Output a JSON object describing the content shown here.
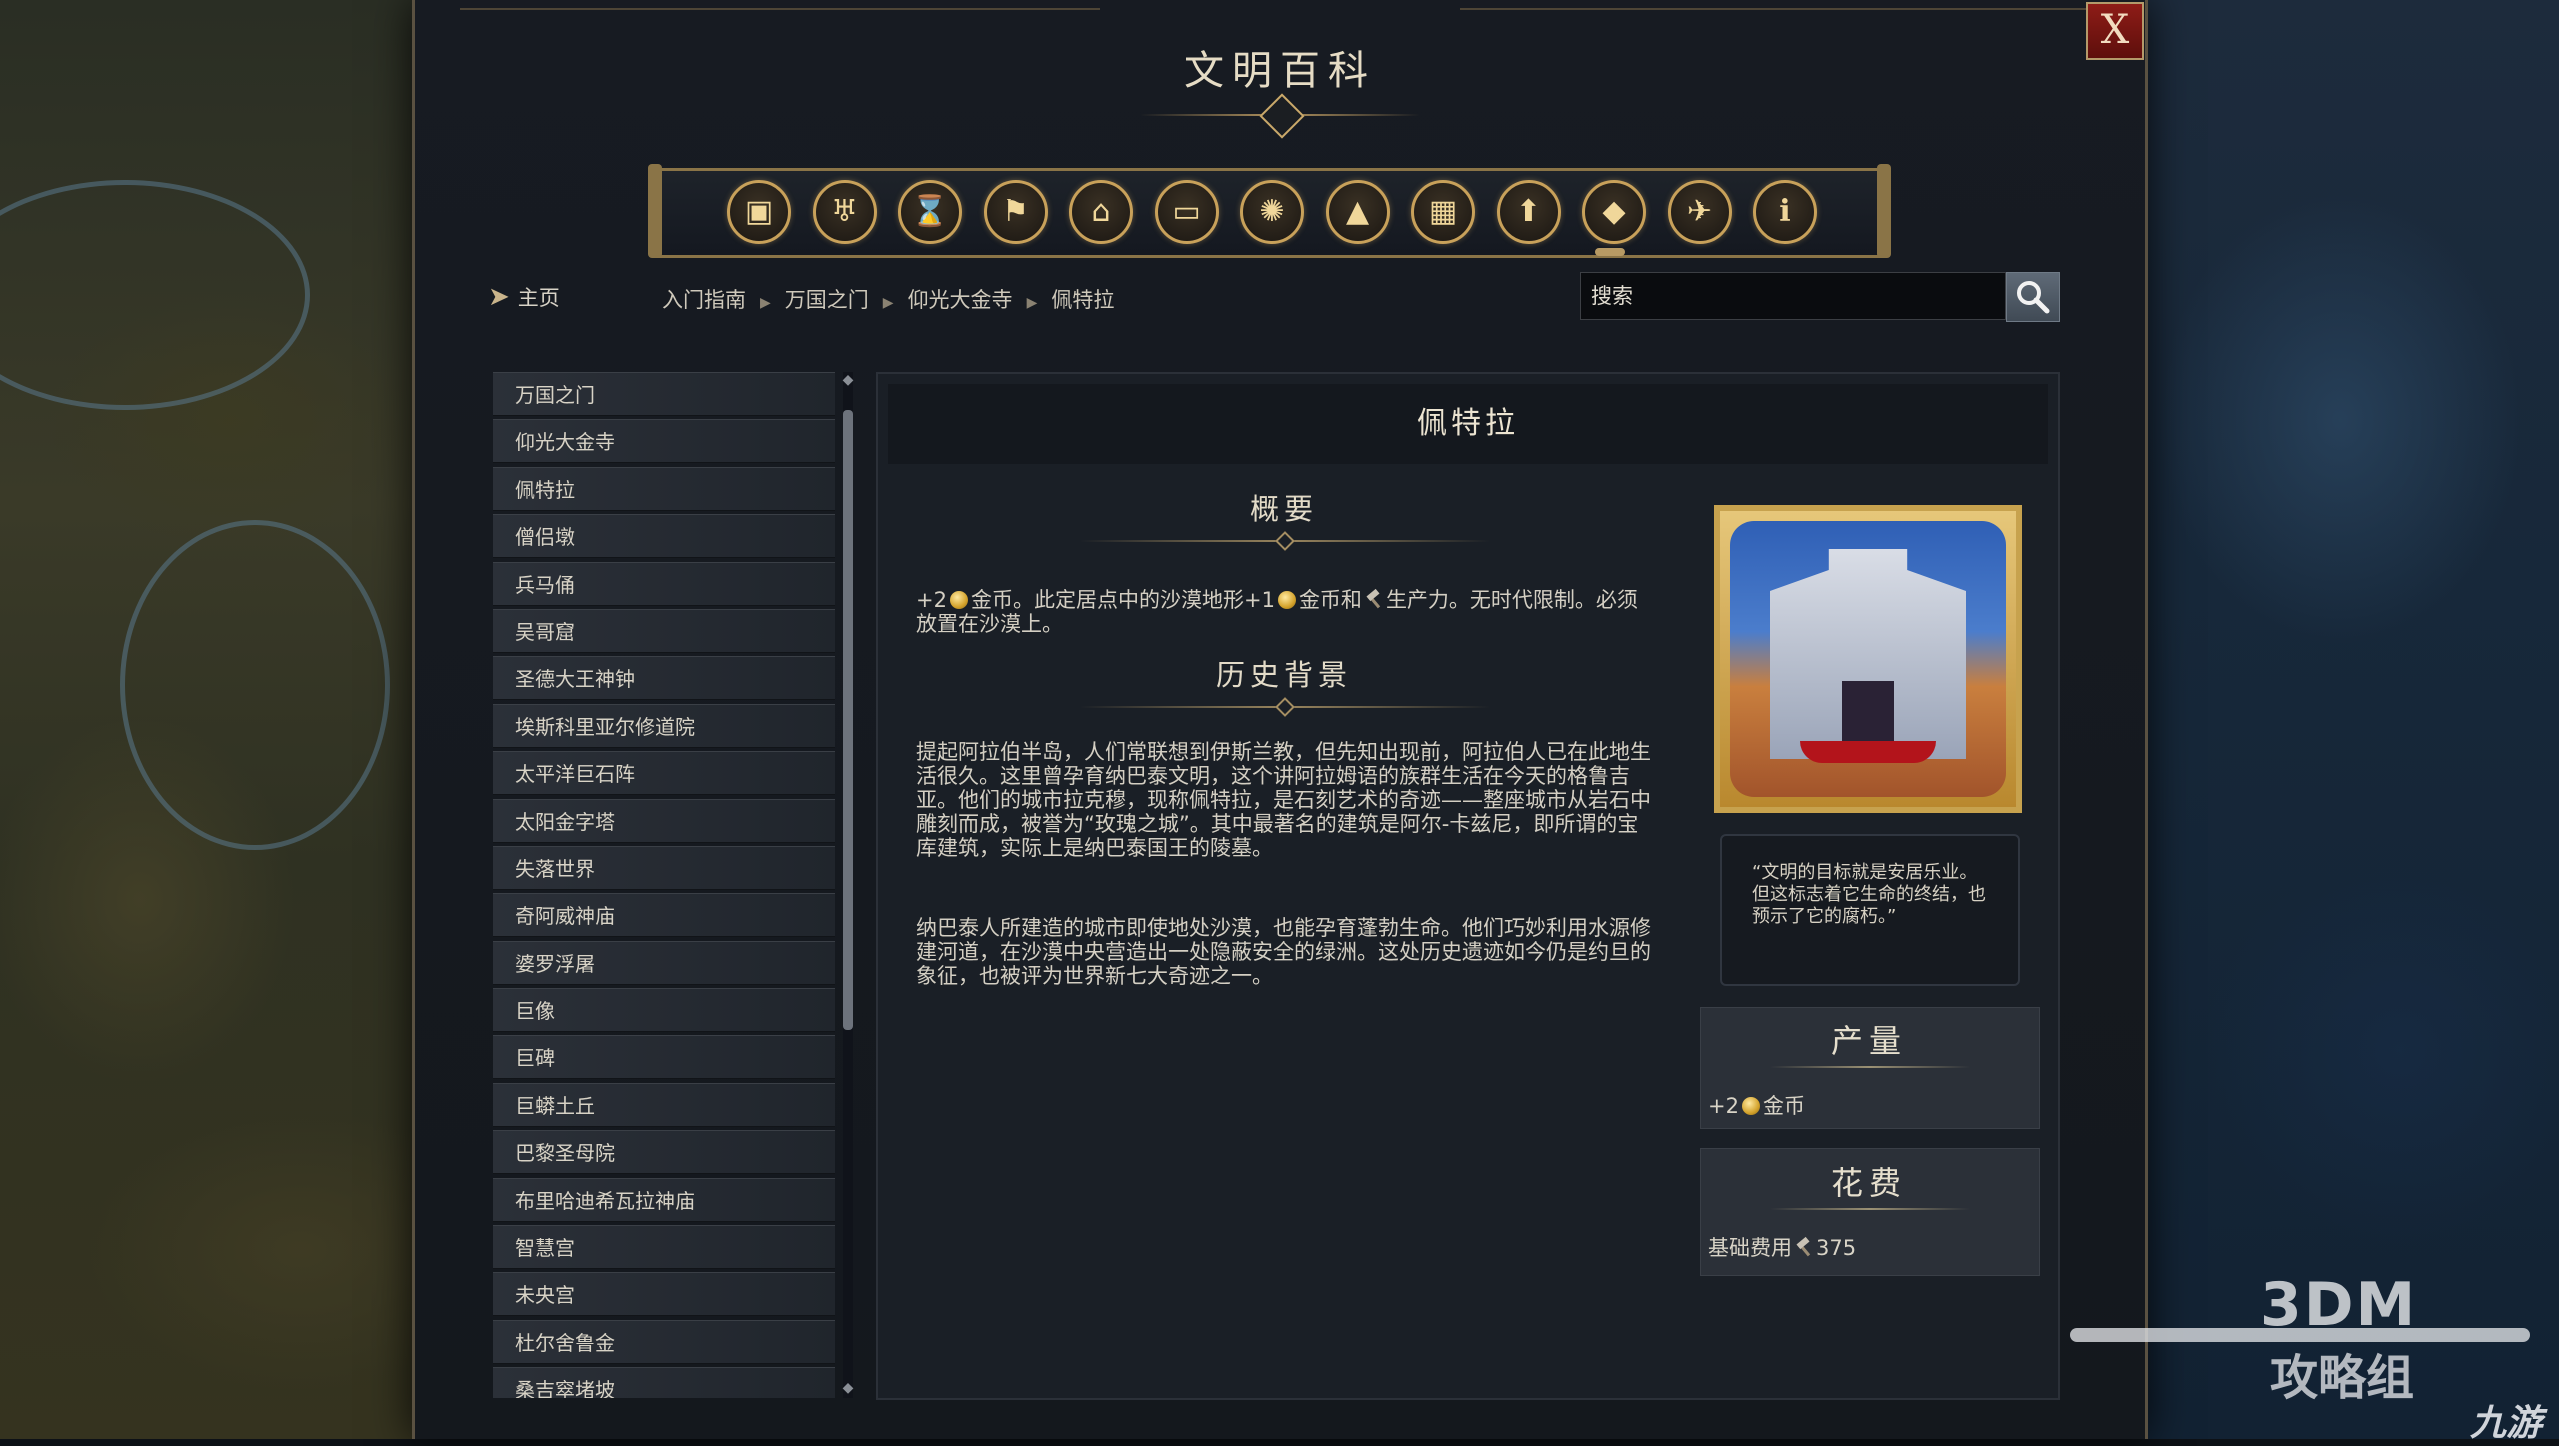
{
  "window": {
    "title": "文明百科",
    "close_label": "X"
  },
  "categories": [
    {
      "icon": "package-icon",
      "glyph": "▣"
    },
    {
      "icon": "goblet-icon",
      "glyph": "♅"
    },
    {
      "icon": "hourglass-icon",
      "glyph": "⌛"
    },
    {
      "icon": "flag-icon",
      "glyph": "⚑"
    },
    {
      "icon": "building-icon",
      "glyph": "⌂"
    },
    {
      "icon": "book-icon",
      "glyph": "▭"
    },
    {
      "icon": "atom-icon",
      "glyph": "✺"
    },
    {
      "icon": "terrain-icon",
      "glyph": "▲"
    },
    {
      "icon": "district-icon",
      "glyph": "▦"
    },
    {
      "icon": "upgrade-arrow-icon",
      "glyph": "⬆"
    },
    {
      "icon": "wonder-pyramid-icon",
      "glyph": "◆"
    },
    {
      "icon": "dove-icon",
      "glyph": "✈"
    },
    {
      "icon": "info-icon",
      "glyph": "i"
    }
  ],
  "nav": {
    "home_label": "主页",
    "breadcrumb": [
      "入门指南",
      "万国之门",
      "仰光大金寺",
      "佩特拉"
    ],
    "search_placeholder": "搜索"
  },
  "list_items": [
    "万国之门",
    "仰光大金寺",
    "佩特拉",
    "僧侣墩",
    "兵马俑",
    "吴哥窟",
    "圣德大王神钟",
    "埃斯科里亚尔修道院",
    "太平洋巨石阵",
    "太阳金字塔",
    "失落世界",
    "奇阿威神庙",
    "婆罗浮屠",
    "巨像",
    "巨碑",
    "巨蟒土丘",
    "巴黎圣母院",
    "布里哈迪希瓦拉神庙",
    "智慧宫",
    "未央宫",
    "杜尔舍鲁金",
    "桑吉窣堵坡"
  ],
  "article": {
    "name": "佩特拉",
    "overview_title": "概要",
    "overview": {
      "prefix": "+2",
      "part1": "金币。此定居点中的沙漠地形+1",
      "part2": "金币和",
      "part3": "生产力。无时代限制。必须放置在沙漠上。"
    },
    "history_title": "历史背景",
    "history_p1": "提起阿拉伯半岛，人们常联想到伊斯兰教，但先知出现前，阿拉伯人已在此地生活很久。这里曾孕育纳巴泰文明，这个讲阿拉姆语的族群生活在今天的格鲁吉亚。他们的城市拉克穆，现称佩特拉，是石刻艺术的奇迹——整座城市从岩石中雕刻而成，被誉为“玫瑰之城”。其中最著名的建筑是阿尔-卡兹尼，即所谓的宝库建筑，实际上是纳巴泰国王的陵墓。",
    "history_p2": "纳巴泰人所建造的城市即使地处沙漠，也能孕育蓬勃生命。他们巧妙利用水源修建河道，在沙漠中央营造出一处隐蔽安全的绿洲。这处历史遗迹如今仍是约旦的象征，也被评为世界新七大奇迹之一。",
    "quote": "“文明的目标就是安居乐业。但这标志着它生命的终结，也预示了它的腐朽。”"
  },
  "yield_card": {
    "title": "产量",
    "amount": "+2",
    "label": "金币"
  },
  "cost_card": {
    "title": "花费",
    "label": "基础费用",
    "amount": "375"
  },
  "watermark": {
    "brand": "3DM",
    "sub": "攻略组",
    "corner": "九游"
  },
  "colors": {
    "gold": "#c8a15a",
    "close_red": "#8e1c17",
    "panel": "#1a1f26"
  }
}
